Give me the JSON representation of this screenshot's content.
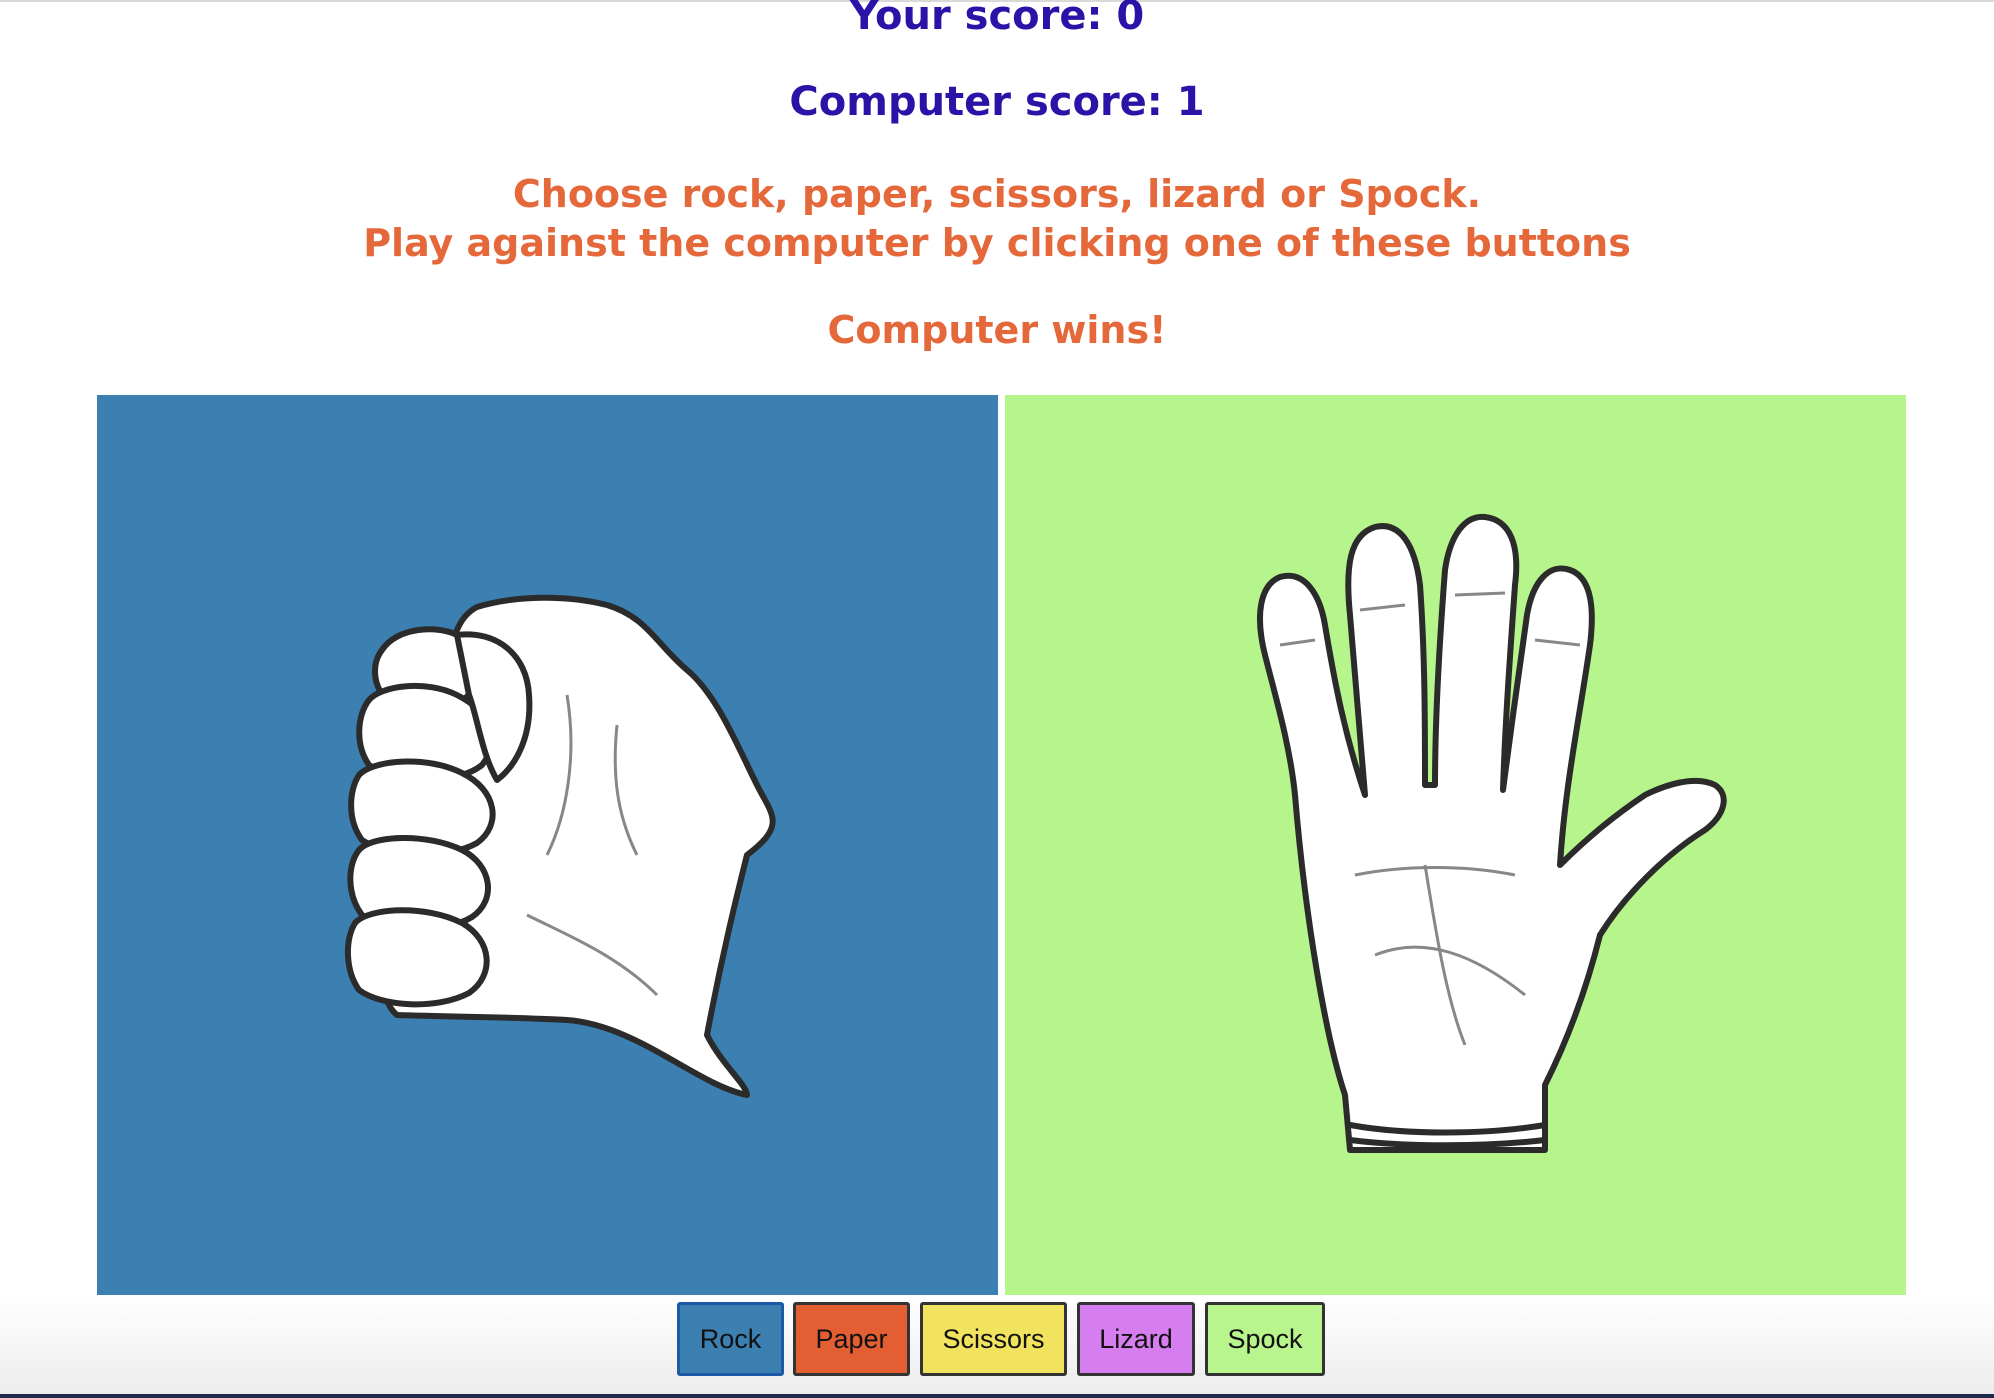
{
  "scoreboard": {
    "player_score": "Your score: 0",
    "computer_score": "Computer score: 1"
  },
  "instructions": {
    "line1": "Choose rock, paper, scissors, lizard or Spock.",
    "line2": "Play against the computer by clicking one of these buttons"
  },
  "result": "Computer wins!",
  "player_choice": {
    "icon": "rock-fist-icon",
    "background": "#3c7fb1"
  },
  "computer_choice": {
    "icon": "spock-hand-icon",
    "background": "#b6f58c"
  },
  "buttons": [
    {
      "label": "Rock",
      "color": "#3c7fb1"
    },
    {
      "label": "Paper",
      "color": "#e45e34"
    },
    {
      "label": "Scissors",
      "color": "#f2e35f"
    },
    {
      "label": "Lizard",
      "color": "#d67ef0"
    },
    {
      "label": "Spock",
      "color": "#b8f58c"
    }
  ]
}
